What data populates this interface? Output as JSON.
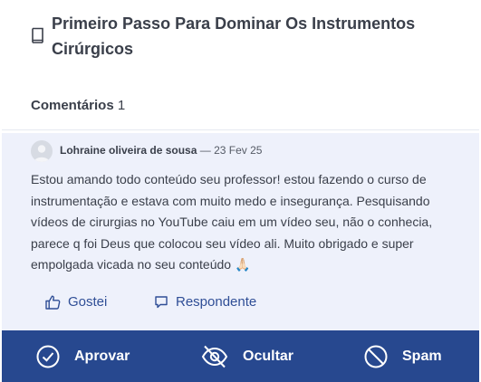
{
  "post": {
    "title": "Primeiro Passo Para Dominar Os Instrumentos Cirúrgicos",
    "icon": "book-icon"
  },
  "comments": {
    "label": "Comentários",
    "count": "1"
  },
  "comment": {
    "author": "Lohraine oliveira de sousa",
    "separator": "—",
    "date": "23 Fev 25",
    "text": "Estou amando todo conteúdo seu professor! estou fazendo o curso de instrumentação e estava com muito medo e insegurança. Pesquisando vídeos de cirurgias no YouTube caiu em um vídeo seu, não o conhecia, parece q foi Deus que colocou seu vídeo ali. Muito obrigado e super empolgada vicada no seu conteúdo 🙏🏻",
    "like_label": "Gostei",
    "reply_label": "Respondente"
  },
  "moderation": {
    "approve_label": "Aprovar",
    "hide_label": "Ocultar",
    "spam_label": "Spam"
  },
  "colors": {
    "card_bg": "#eef1fb",
    "bar_bg": "#27488f",
    "action_blue": "#2f4e96",
    "text": "#3a3f4a"
  }
}
